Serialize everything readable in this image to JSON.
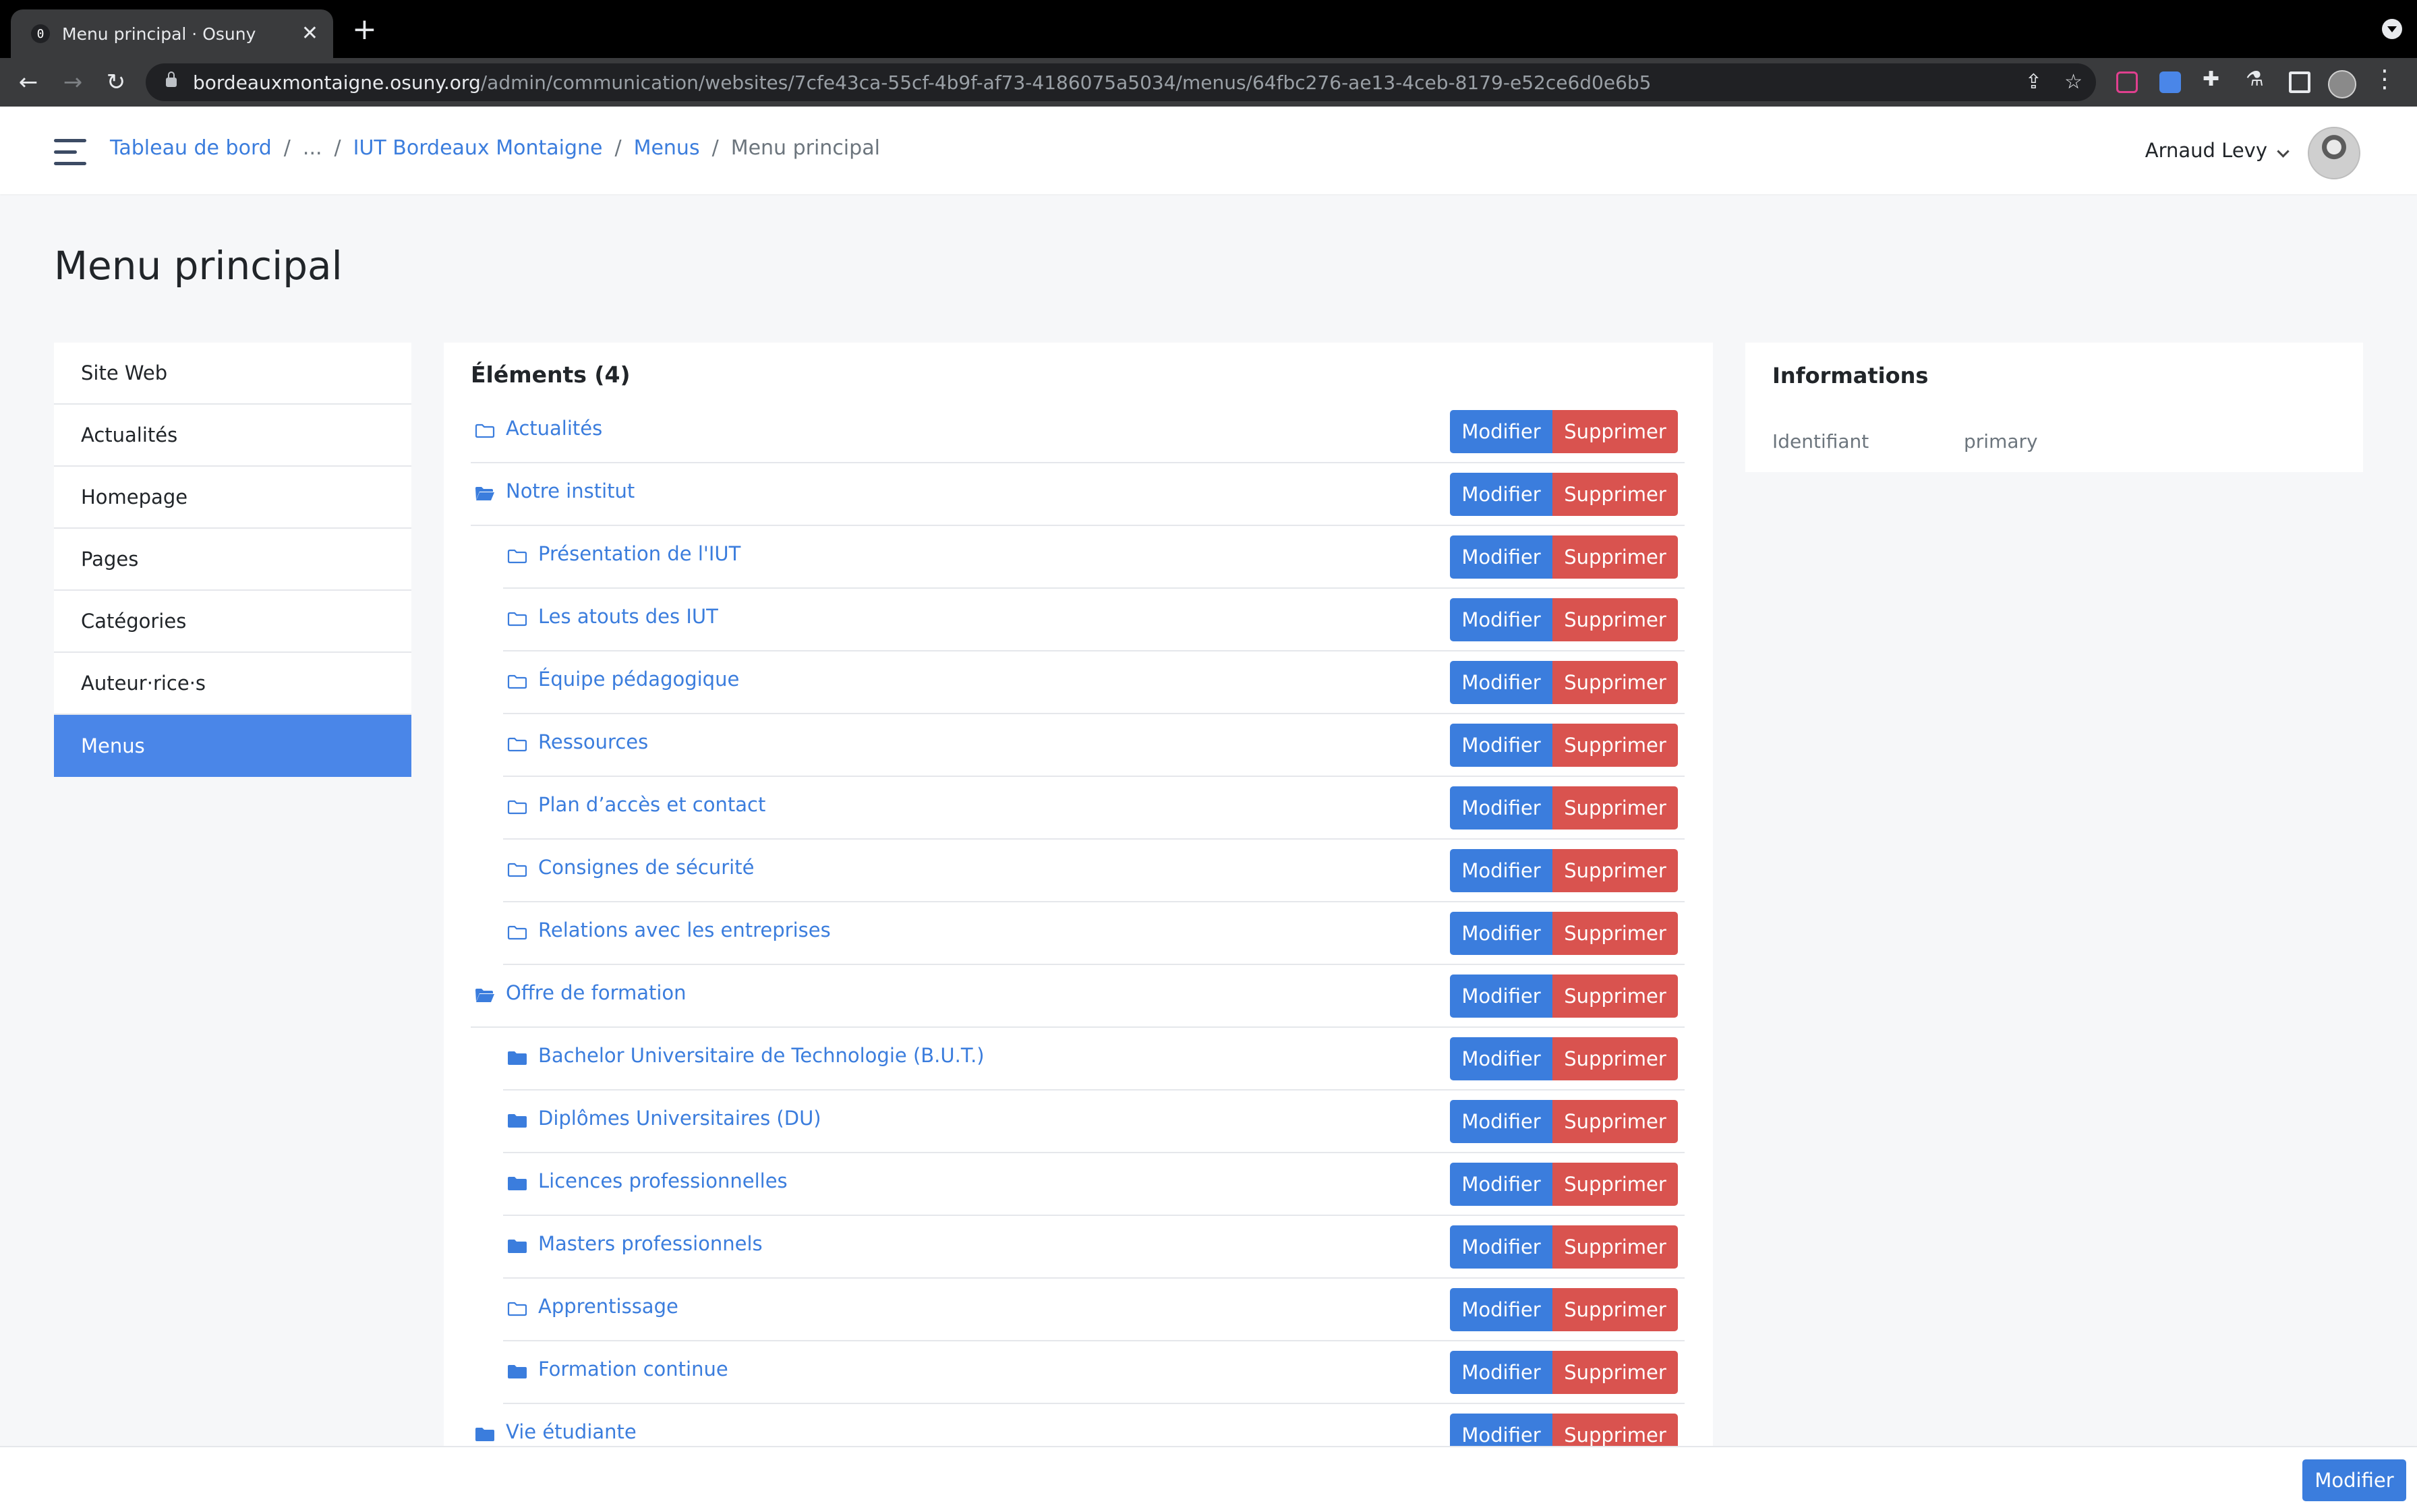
{
  "browser": {
    "tab_title": "Menu principal · Osuny",
    "url_host": "bordeauxmontaigne.osuny.org",
    "url_path": "/admin/communication/websites/7cfe43ca-55cf-4b9f-af73-4186075a5034/menus/64fbc276-ae13-4ceb-8179-e52ce6d0e6b5",
    "favicon_text": "0"
  },
  "header": {
    "breadcrumb": [
      "Tableau de bord",
      "...",
      "IUT Bordeaux Montaigne",
      "Menus",
      "Menu principal"
    ],
    "user_name": "Arnaud Levy"
  },
  "page": {
    "title": "Menu principal"
  },
  "sidebar": {
    "items": [
      {
        "label": "Site Web"
      },
      {
        "label": "Actualités"
      },
      {
        "label": "Homepage"
      },
      {
        "label": "Pages"
      },
      {
        "label": "Catégories"
      },
      {
        "label": "Auteur·rice·s"
      },
      {
        "label": "Menus",
        "active": true
      }
    ]
  },
  "elements": {
    "title": "Éléments (4)",
    "edit_label": "Modifier",
    "delete_label": "Supprimer",
    "items": [
      {
        "label": "Actualités",
        "level": 0,
        "icon": "folder-outline-icon"
      },
      {
        "label": "Notre institut",
        "level": 0,
        "icon": "folder-open-icon"
      },
      {
        "label": "Présentation de l'IUT",
        "level": 1,
        "icon": "folder-outline-icon"
      },
      {
        "label": "Les atouts des IUT",
        "level": 1,
        "icon": "folder-outline-icon"
      },
      {
        "label": "Équipe pédagogique",
        "level": 1,
        "icon": "folder-outline-icon"
      },
      {
        "label": "Ressources",
        "level": 1,
        "icon": "folder-outline-icon"
      },
      {
        "label": "Plan d’accès et contact",
        "level": 1,
        "icon": "folder-outline-icon"
      },
      {
        "label": "Consignes de sécurité",
        "level": 1,
        "icon": "folder-outline-icon"
      },
      {
        "label": "Relations avec les entreprises",
        "level": 1,
        "icon": "folder-outline-icon"
      },
      {
        "label": "Offre de formation",
        "level": 0,
        "icon": "folder-open-icon"
      },
      {
        "label": "Bachelor Universitaire de Technologie (B.U.T.)",
        "level": 1,
        "icon": "folder-filled-icon"
      },
      {
        "label": "Diplômes Universitaires (DU)",
        "level": 1,
        "icon": "folder-filled-icon"
      },
      {
        "label": "Licences professionnelles",
        "level": 1,
        "icon": "folder-filled-icon"
      },
      {
        "label": "Masters professionnels",
        "level": 1,
        "icon": "folder-filled-icon"
      },
      {
        "label": "Apprentissage",
        "level": 1,
        "icon": "folder-outline-icon"
      },
      {
        "label": "Formation continue",
        "level": 1,
        "icon": "folder-filled-icon"
      },
      {
        "label": "Vie étudiante",
        "level": 0,
        "icon": "folder-filled-icon"
      }
    ]
  },
  "info": {
    "title": "Informations",
    "key": "Identifiant",
    "value": "primary"
  },
  "footer": {
    "button_label": "Modifier"
  },
  "colors": {
    "primary": "#3b7ddd",
    "danger": "#d9534f",
    "active_nav": "#4a86e8"
  }
}
